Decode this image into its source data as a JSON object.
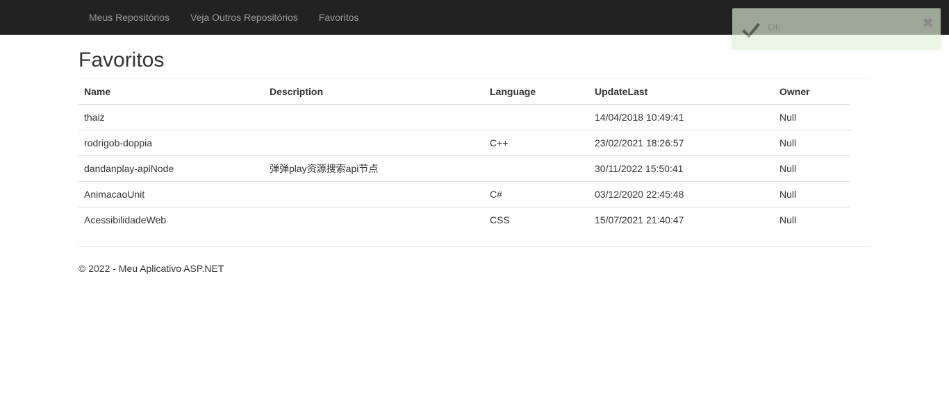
{
  "navbar": {
    "items": [
      {
        "label": "Meus Repositórios"
      },
      {
        "label": "Veja Outros Repositórios"
      },
      {
        "label": "Favoritos"
      }
    ]
  },
  "page": {
    "title": "Favoritos"
  },
  "table": {
    "headers": {
      "name": "Name",
      "description": "Description",
      "language": "Language",
      "update_last": "UpdateLast",
      "owner": "Owner"
    },
    "rows": [
      {
        "name": "thaiz",
        "description": "",
        "language": "",
        "update_last": "14/04/2018 10:49:41",
        "owner": "Null"
      },
      {
        "name": "rodrigob-doppia",
        "description": "",
        "language": "C++",
        "update_last": "23/02/2021 18:26:57",
        "owner": "Null"
      },
      {
        "name": "dandanplay-apiNode",
        "description": "弹弹play资源搜索api节点",
        "language": "",
        "update_last": "30/11/2022 15:50:41",
        "owner": "Null"
      },
      {
        "name": "AnimacaoUnit",
        "description": "",
        "language": "C#",
        "update_last": "03/12/2020 22:45:48",
        "owner": "Null"
      },
      {
        "name": "AcessibilidadeWeb",
        "description": "",
        "language": "CSS",
        "update_last": "15/07/2021 21:40:47",
        "owner": "Null"
      }
    ]
  },
  "footer": {
    "text": "© 2022 - Meu Aplicativo ASP.NET"
  },
  "toast": {
    "message": "Ok",
    "close_symbol": "✖",
    "icon": "checkmark-icon",
    "color": "#dff0d8"
  },
  "colors": {
    "navbar_bg": "#222222",
    "nav_link": "#9d9d9d"
  }
}
